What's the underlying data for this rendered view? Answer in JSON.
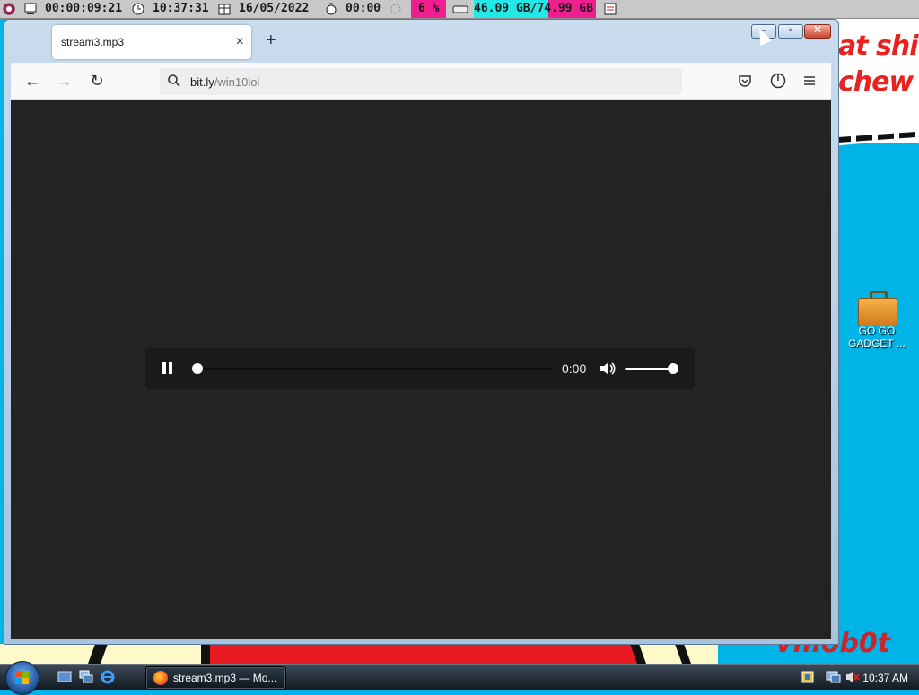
{
  "statusbar": {
    "uptime": "00:00:09:21",
    "time": "10:37:31",
    "date": "16/05/2022",
    "timer": "00:00",
    "cpu": "6 %",
    "disk": "46.09 GB/74.99 GB"
  },
  "browser": {
    "tab_title": "stream3.mp3",
    "url_host": "bit.ly",
    "url_path": "/win10lol"
  },
  "player": {
    "time": "0:00",
    "progress_fraction": 0.0,
    "volume_fraction": 1.0
  },
  "wallpaper": {
    "line1": "at shit",
    "line2": "chew",
    "signature": "vmob0t"
  },
  "desktop": {
    "icon_label": "GO GO GADGET ..."
  },
  "taskbar": {
    "task_label": "stream3.mp3 — Mo...",
    "clock": "10:37 AM"
  },
  "colors": {
    "desktop": "#00b4e8",
    "content_bg": "#232323",
    "cpu_highlight": "#ef1f8f",
    "disk_highlight": "#22e8e8"
  }
}
